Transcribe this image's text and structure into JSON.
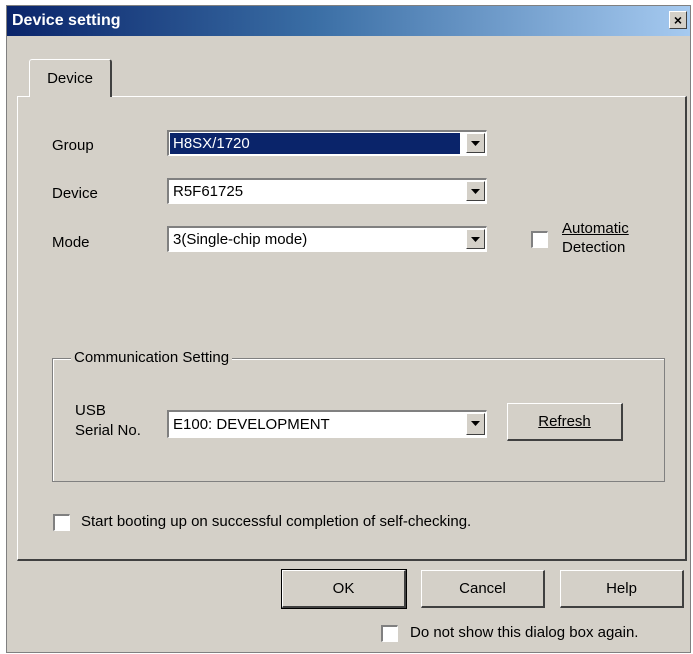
{
  "window": {
    "title": "Device setting",
    "close_glyph": "×"
  },
  "tabs": [
    {
      "label": "Device"
    }
  ],
  "form": {
    "group": {
      "label": "Group",
      "value": "H8SX/1720"
    },
    "device": {
      "label": "Device",
      "value": "R5F61725"
    },
    "mode": {
      "label": "Mode",
      "value": "3(Single-chip mode)"
    },
    "auto_detection": {
      "label_line1": "Automatic",
      "label_line2": "Detection",
      "accesskey": "A",
      "checked": false
    }
  },
  "communication": {
    "title": "Communication Setting",
    "usb_label_line1": "USB",
    "usb_label_line2": "Serial No.",
    "serial_value": "E100: DEVELOPMENT",
    "refresh_label": "Refresh",
    "refresh_accesskey": "R"
  },
  "boot_option": {
    "label": "Start booting up on successful completion of self-checking.",
    "checked": false
  },
  "buttons": {
    "ok": "OK",
    "cancel": "Cancel",
    "help": "Help"
  },
  "footer": {
    "dont_show_label": "Do not show this dialog box again.",
    "checked": false
  },
  "colors": {
    "face": "#d4d0c8",
    "title_start": "#0a246a",
    "title_end": "#a6caf0",
    "selection": "#0a246a"
  }
}
